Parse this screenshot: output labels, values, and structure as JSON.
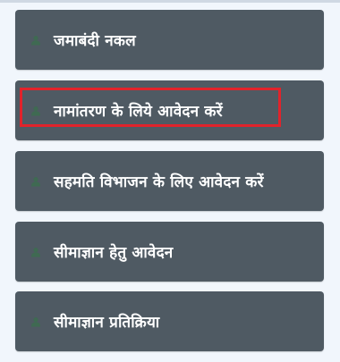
{
  "menu": {
    "items": [
      {
        "label": "जमाबंदी नकल",
        "icon": "user-icon"
      },
      {
        "label": "नामांतरण के लिये आवेदन करें",
        "icon": "user-icon"
      },
      {
        "label": "सहमति विभाजन के लिए आवेदन करें",
        "icon": "user-icon"
      },
      {
        "label": "सीमाज्ञान हेतु आवेदन",
        "icon": "user-icon"
      },
      {
        "label": "सीमाज्ञान प्रतिक्रिया",
        "icon": "user-icon"
      }
    ],
    "highlighted_index": 1
  },
  "colors": {
    "page_background": "#f1f6fc",
    "item_background": "#4f5a63",
    "item_text": "#ffffff",
    "bullet_icon": "#3f6a52",
    "highlight_border": "#e1232b"
  }
}
